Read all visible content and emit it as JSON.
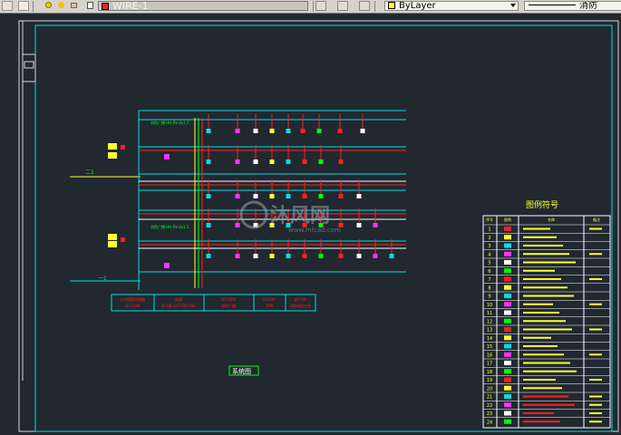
{
  "toolbar": {
    "layer_name": "WIRE-1",
    "layer_color": "#ff2020",
    "color_dropdown": "ByLayer",
    "color_swatch": "#ffff33",
    "linetype_dropdown": "消防"
  },
  "drawing": {
    "legend_title": "图例符号",
    "legend_headers": [
      "序号",
      "图例",
      "名称",
      "备注"
    ],
    "row_numbers": [
      "1",
      "2",
      "3",
      "4",
      "5",
      "6",
      "7",
      "8",
      "9",
      "10",
      "11",
      "12",
      "13",
      "14",
      "15",
      "16",
      "17",
      "18",
      "19",
      "20",
      "21",
      "22",
      "23",
      "24"
    ],
    "side_label_1": "二1",
    "side_label_2": "一1",
    "floor_label_top": "消防广播 HH-RV-4x1.5",
    "floor_label_bottom": "消防广播 HH-RV-4x1.5",
    "note_label": "系统图",
    "equip_1_title": "火灾报警控制器",
    "equip_1_sub": "LD-128K",
    "equip_2_title": "电源",
    "equip_2_sub": "JB-QB-GST500/160",
    "equip_3_title": "LD-5304",
    "equip_3_sub": "消防广播",
    "equip_4_title": "DC24V",
    "equip_4_sub": "TAPI",
    "equip_5_title": "JKF-KS",
    "equip_5_sub": "消防电话主机"
  }
}
